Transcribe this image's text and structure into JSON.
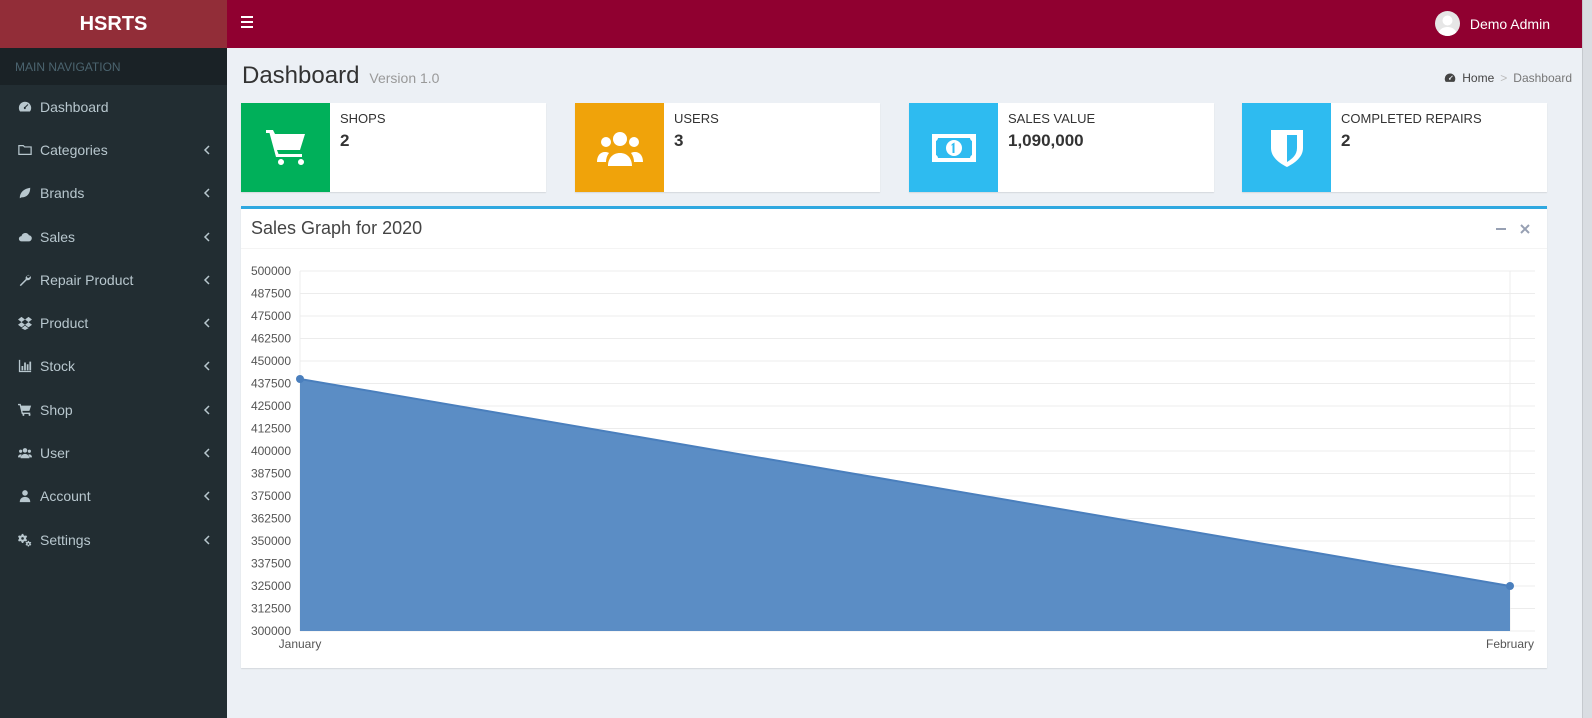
{
  "brand": "HSRTS",
  "sidebar": {
    "header": "MAIN NAVIGATION",
    "items": [
      {
        "label": "Dashboard",
        "icon": "dashboard-icon",
        "has_children": false
      },
      {
        "label": "Categories",
        "icon": "folder-icon",
        "has_children": true
      },
      {
        "label": "Brands",
        "icon": "leaf-icon",
        "has_children": true
      },
      {
        "label": "Sales",
        "icon": "cloud-icon",
        "has_children": true
      },
      {
        "label": "Repair Product",
        "icon": "wrench-icon",
        "has_children": true
      },
      {
        "label": "Product",
        "icon": "dropbox-icon",
        "has_children": true
      },
      {
        "label": "Stock",
        "icon": "bar-chart-icon",
        "has_children": true
      },
      {
        "label": "Shop",
        "icon": "cart-icon",
        "has_children": true
      },
      {
        "label": "User",
        "icon": "users-icon",
        "has_children": true
      },
      {
        "label": "Account",
        "icon": "user-icon",
        "has_children": true
      },
      {
        "label": "Settings",
        "icon": "gears-icon",
        "has_children": true
      }
    ]
  },
  "topbar": {
    "user_name": "Demo Admin"
  },
  "page": {
    "title": "Dashboard",
    "subtitle": "Version 1.0",
    "breadcrumb": {
      "home": "Home",
      "current": "Dashboard"
    }
  },
  "stats": [
    {
      "label": "SHOPS",
      "value": "2",
      "color": "#00b05a",
      "icon": "cart-icon"
    },
    {
      "label": "USERS",
      "value": "3",
      "color": "#f0a30a",
      "icon": "users-icon"
    },
    {
      "label": "SALES VALUE",
      "value": "1,090,000",
      "color": "#2ebbf0",
      "icon": "money-icon"
    },
    {
      "label": "COMPLETED REPAIRS",
      "value": "2",
      "color": "#2ebbf0",
      "icon": "shield-icon"
    }
  ],
  "box": {
    "title": "Sales Graph for 2020"
  },
  "chart_data": {
    "type": "area",
    "title": "Sales Graph for 2020",
    "categories": [
      "January",
      "February"
    ],
    "series": [
      {
        "values": [
          440000,
          325000
        ]
      }
    ],
    "ylim": [
      300000,
      500000
    ],
    "yticks": [
      "500000",
      "487500",
      "475000",
      "462500",
      "450000",
      "437500",
      "425000",
      "412500",
      "400000",
      "387500",
      "375000",
      "362500",
      "350000",
      "337500",
      "325000",
      "312500",
      "300000"
    ],
    "fill_color": "#5b8dc5",
    "grid": true
  }
}
